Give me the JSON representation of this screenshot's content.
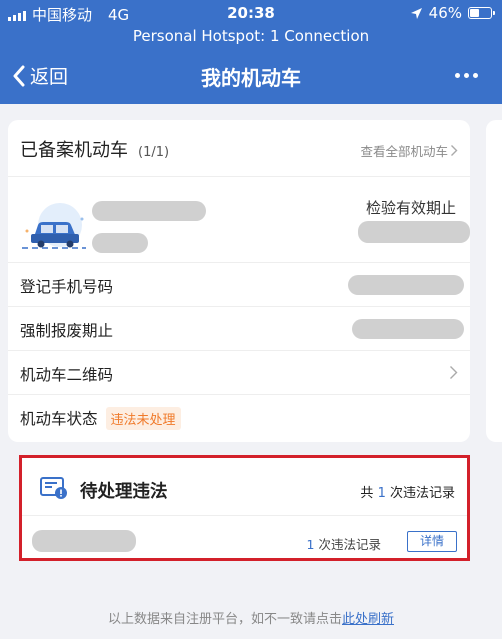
{
  "status_bar": {
    "carrier": "中国移动",
    "network": "4G",
    "time": "20:38",
    "battery": "46%",
    "battery_level": 0.46
  },
  "hotspot": {
    "text": "Personal Hotspot: 1 Connection"
  },
  "navbar": {
    "back_label": "返回",
    "title": "我的机动车",
    "more_icon": "more-dots-icon"
  },
  "vehicle_card": {
    "title": "已备案机动车",
    "count": "(1/1)",
    "view_all": "查看全部机动车",
    "inspection_label": "检验有效期止",
    "rows": [
      {
        "label": "登记手机号码"
      },
      {
        "label": "强制报废期止"
      },
      {
        "label": "机动车二维码"
      },
      {
        "label": "机动车状态",
        "tag": "违法未处理"
      }
    ]
  },
  "violations": {
    "title": "待处理违法",
    "total_prefix": "共",
    "total_count": "1",
    "total_suffix": "次违法记录",
    "item_count": "1",
    "item_suffix": "次违法记录",
    "detail_label": "详情"
  },
  "footer": {
    "text": "以上数据来自注册平台，如不一致请点击",
    "link": "此处刷新"
  },
  "colors": {
    "primary": "#3a71c9",
    "warning_text": "#f07a2a",
    "warning_bg": "#fdeee2",
    "highlight_border": "#d3202a"
  }
}
